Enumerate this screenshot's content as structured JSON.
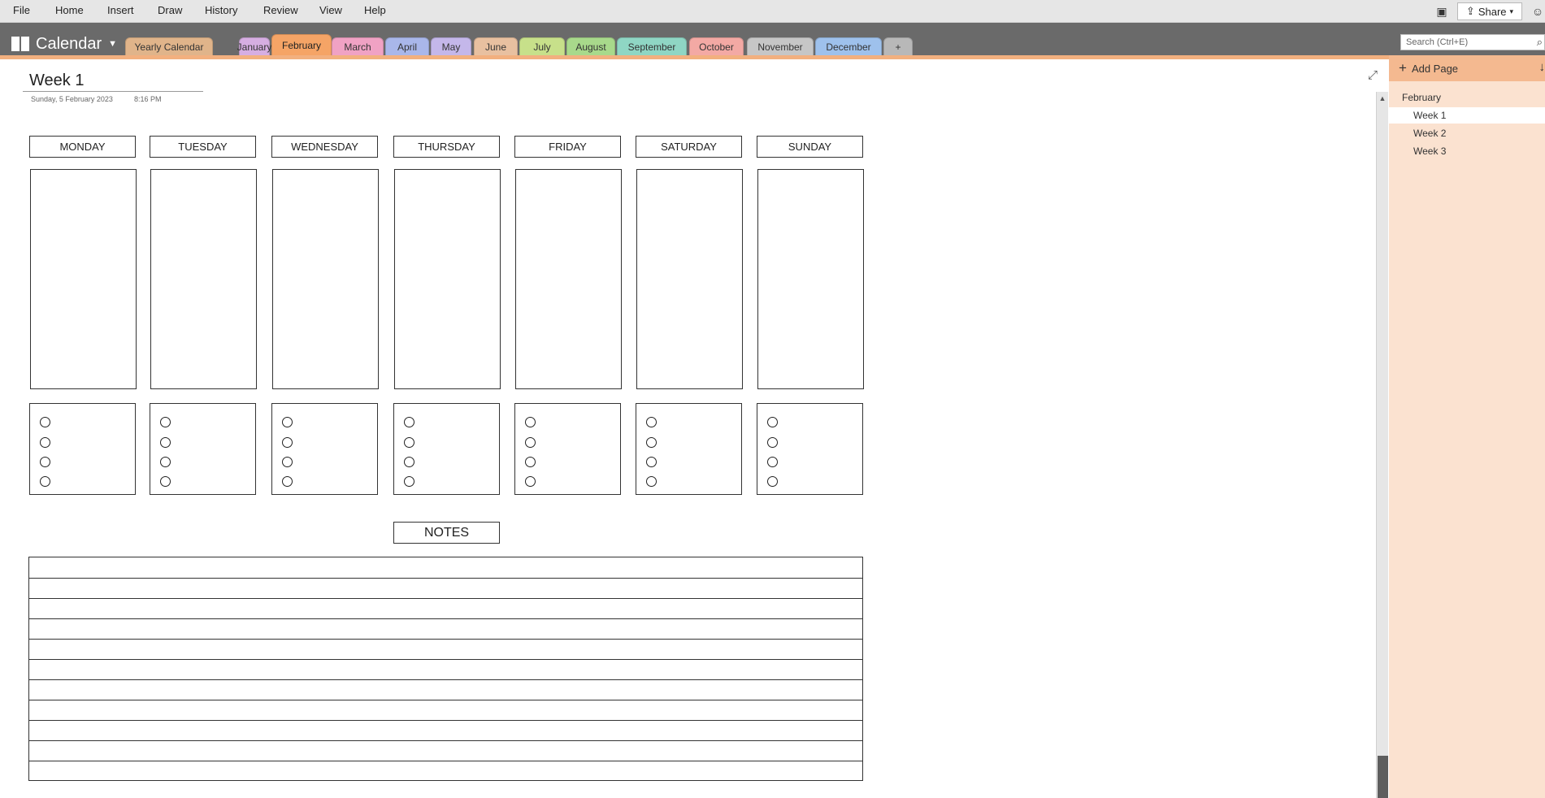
{
  "menu": [
    "File",
    "Home",
    "Insert",
    "Draw",
    "History",
    "Review",
    "View",
    "Help"
  ],
  "share_label": "Share",
  "notebook_name": "Calendar",
  "tabs": [
    {
      "label": "Yearly Calendar",
      "color": "#e0b48a"
    },
    {
      "label": "January",
      "color": "#d6aee2"
    },
    {
      "label": "February",
      "color": "#f5a466",
      "active": true
    },
    {
      "label": "March",
      "color": "#f0a2c4"
    },
    {
      "label": "April",
      "color": "#a9b7ea"
    },
    {
      "label": "May",
      "color": "#c4b7ea"
    },
    {
      "label": "June",
      "color": "#e8c0a0"
    },
    {
      "label": "July",
      "color": "#c7e08a"
    },
    {
      "label": "August",
      "color": "#a8d98b"
    },
    {
      "label": "September",
      "color": "#8fd6c4"
    },
    {
      "label": "October",
      "color": "#f3a9a4"
    },
    {
      "label": "November",
      "color": "#c6c6c6"
    },
    {
      "label": "December",
      "color": "#9ec1ec"
    },
    {
      "label": "+",
      "color": "#b8b8b8"
    }
  ],
  "search_placeholder": "Search (Ctrl+E)",
  "page": {
    "title": "Week 1",
    "date": "Sunday, 5 February 2023",
    "time": "8:16 PM",
    "days": [
      "MONDAY",
      "TUESDAY",
      "WEDNESDAY",
      "THURSDAY",
      "FRIDAY",
      "SATURDAY",
      "SUNDAY"
    ],
    "notes_label": "NOTES"
  },
  "panel": {
    "add_page": "Add Page",
    "section": "February",
    "pages": [
      "Week 1",
      "Week 2",
      "Week 3"
    ],
    "selected": "Week 1"
  }
}
